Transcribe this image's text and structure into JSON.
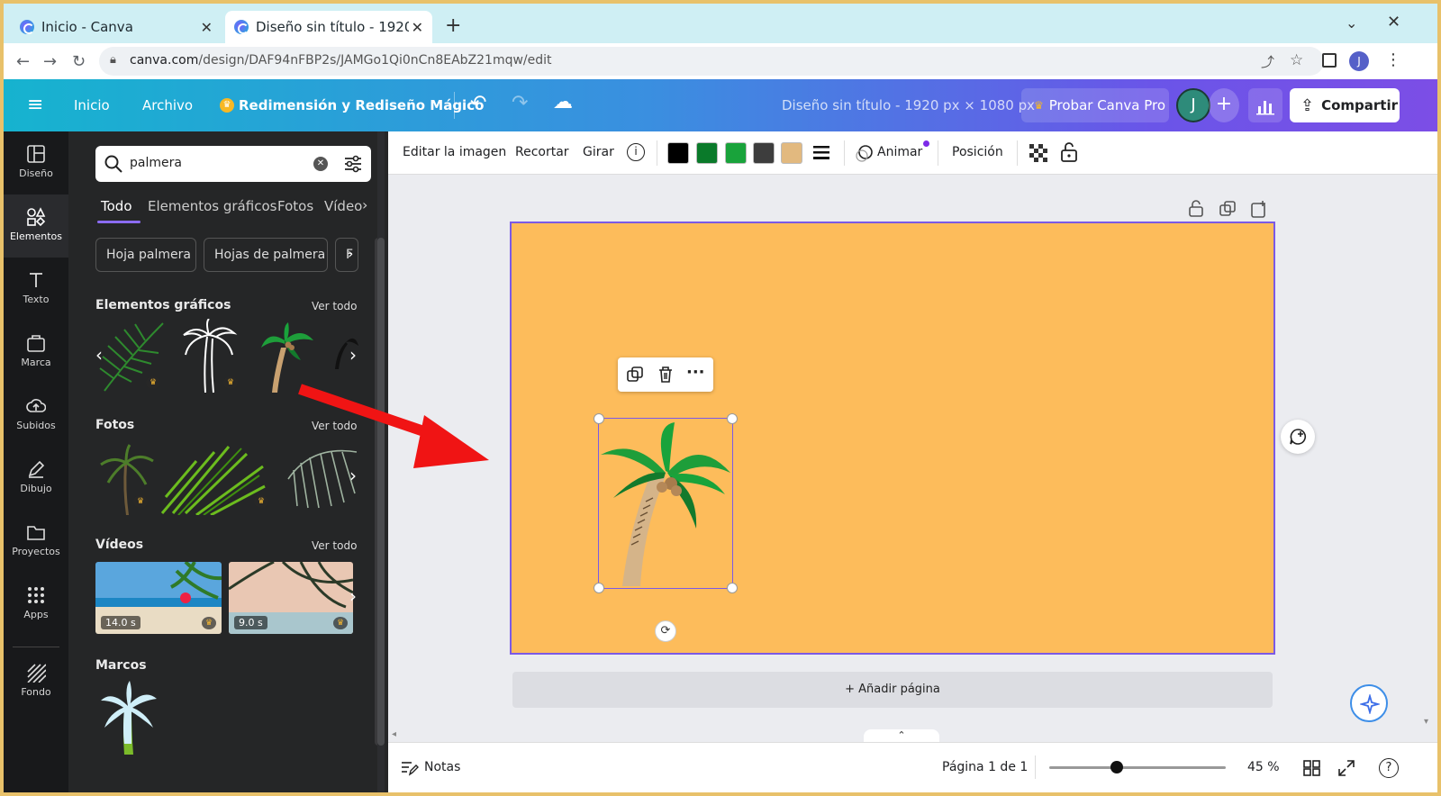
{
  "browser": {
    "tabs": [
      {
        "label": "Inicio - Canva"
      },
      {
        "label": "Diseño sin título - 1920 ×"
      }
    ],
    "url_host": "canva.com",
    "url_path": "/design/DAF94nFBP2s/JAMGo1Qi0nCn8EAbZ21mqw/edit",
    "profile_initial": "J"
  },
  "header": {
    "menu_inicio": "Inicio",
    "menu_archivo": "Archivo",
    "magic": "Redimensión y Rediseño Mágico",
    "doc_title": "Diseño sin título - 1920 px × 1080 px",
    "try_pro": "Probar Canva Pro",
    "avatar_initial": "J",
    "share": "Compartir"
  },
  "rail": {
    "items": [
      {
        "label": "Diseño"
      },
      {
        "label": "Elementos"
      },
      {
        "label": "Texto"
      },
      {
        "label": "Marca"
      },
      {
        "label": "Subidos"
      },
      {
        "label": "Dibujo"
      },
      {
        "label": "Proyectos"
      },
      {
        "label": "Apps"
      },
      {
        "label": "Fondo"
      }
    ]
  },
  "panel": {
    "search_value": "palmera",
    "tabs": [
      "Todo",
      "Elementos gráficos",
      "Fotos",
      "Vídeo"
    ],
    "chips": [
      "Hoja palmera",
      "Hojas de palmera",
      "F"
    ],
    "sections": {
      "graphics": "Elementos gráficos",
      "photos": "Fotos",
      "videos": "Vídeos",
      "frames": "Marcos"
    },
    "see_all": "Ver todo",
    "video_durations": [
      "14.0 s",
      "9.0 s"
    ]
  },
  "toolbar": {
    "edit_image": "Editar la imagen",
    "crop": "Recortar",
    "flip": "Girar",
    "animate": "Animar",
    "position": "Posición",
    "colors": [
      "#000000",
      "#0a7a2a",
      "#19a33b",
      "#3d3d3d",
      "#e2b97f"
    ]
  },
  "canvas": {
    "page_color": "#fdbc5b",
    "add_page": "+ Añadir página"
  },
  "status": {
    "notes": "Notas",
    "page_info": "Página 1 de 1",
    "zoom_value": 45,
    "zoom": "45 %"
  }
}
